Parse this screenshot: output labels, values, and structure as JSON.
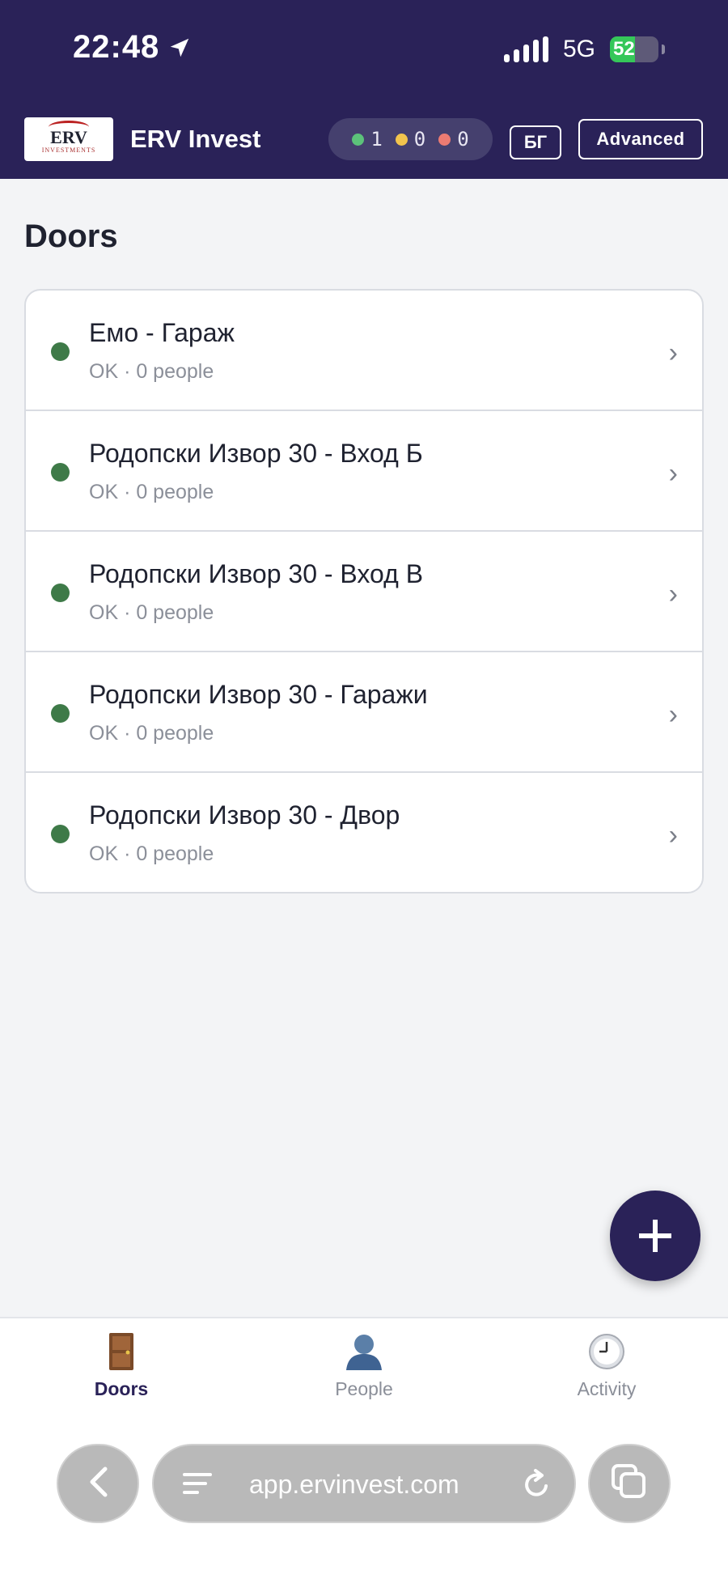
{
  "status_bar": {
    "time": "22:48",
    "network": "5G",
    "battery": "52",
    "battery_level": 0.52
  },
  "header": {
    "logo": "ERV INVESTMENTS",
    "logo_top": "ERV",
    "logo_bottom": "INVESTMENTS",
    "brand": "ERV Invest",
    "counts": [
      {
        "value": "1",
        "color": "#5cc27a"
      },
      {
        "value": "0",
        "color": "#f2c44d"
      },
      {
        "value": "0",
        "color": "#ec7b72"
      }
    ],
    "lang_label": "БГ",
    "advanced_label": "Advanced"
  },
  "main": {
    "title": "Doors",
    "doors": [
      {
        "name": "Емо - Гараж",
        "status": "OK · 0 people",
        "color": "#3e7a48"
      },
      {
        "name": "Родопски Извор 30 - Вход Б",
        "status": "OK · 0 people",
        "color": "#3e7a48"
      },
      {
        "name": "Родопски Извор 30 - Вход В",
        "status": "OK · 0 people",
        "color": "#3e7a48"
      },
      {
        "name": "Родопски Извор 30 - Гаражи",
        "status": "OK · 0 people",
        "color": "#3e7a48"
      },
      {
        "name": "Родопски Извор 30 - Двор",
        "status": "OK · 0 people",
        "color": "#3e7a48"
      }
    ],
    "fab_icon": "plus-icon"
  },
  "tabs": [
    {
      "label": "Doors",
      "icon": "door-icon",
      "active": true
    },
    {
      "label": "People",
      "icon": "person-icon",
      "active": false
    },
    {
      "label": "Activity",
      "icon": "clock-icon",
      "active": false
    }
  ],
  "browser": {
    "url": "app.ervinvest.com"
  }
}
